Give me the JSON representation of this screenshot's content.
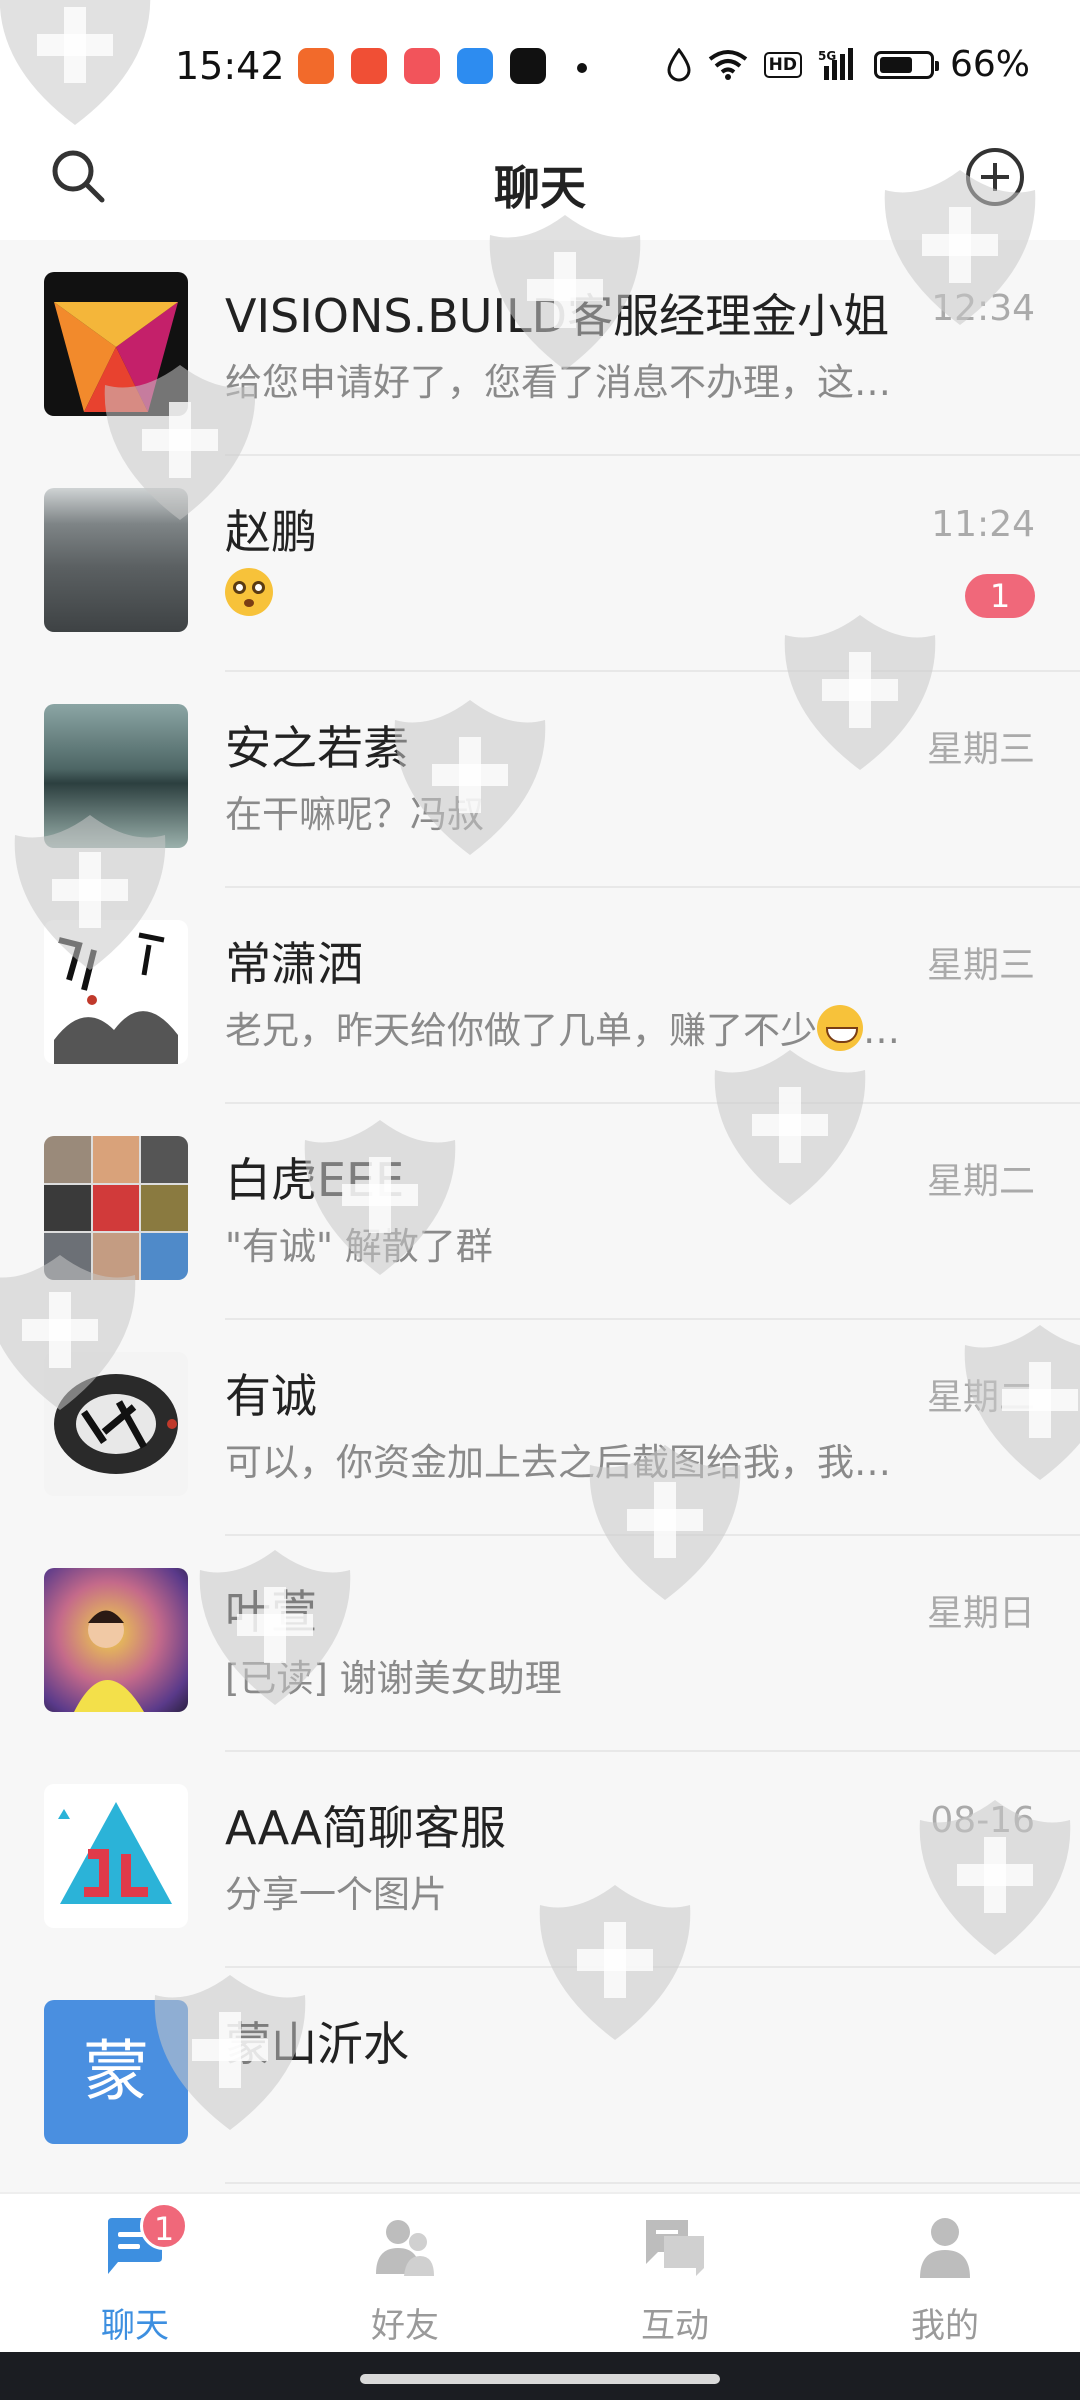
{
  "status_bar": {
    "time": "15:42",
    "network": "5G",
    "hd_label": "HD",
    "battery_text": "66%",
    "battery_level": 0.66,
    "app_icons": [
      "app-notification-icon",
      "video-app-icon",
      "app-notification-icon",
      "chat-app-icon",
      "arrow-app-icon"
    ]
  },
  "header": {
    "title": "聊天",
    "left_icon": "search-icon",
    "right_icon": "plus-circle-icon"
  },
  "chats": [
    {
      "name": "VISIONS.BUILD客服经理金小姐",
      "time": "12:34",
      "preview": "给您申请好了，您看了消息不办理，这…",
      "badge": ""
    },
    {
      "name": "赵鹏",
      "time": "11:24",
      "preview": "",
      "preview_emoji": "flushed-face-emoji",
      "badge": "1"
    },
    {
      "name": "安之若素",
      "time": "星期三",
      "preview": "在干嘛呢？冯叔",
      "badge": ""
    },
    {
      "name": "常潇洒",
      "time": "星期三",
      "preview": "老兄，昨天给你做了几单，赚了不少",
      "preview_suffix": "…",
      "preview_emoji": "grinning-face-emoji",
      "badge": ""
    },
    {
      "name": "白虎EEE",
      "time": "星期二",
      "preview": "\"有诚\" 解散了群",
      "badge": ""
    },
    {
      "name": "有诚",
      "time": "星期二",
      "preview": "可以，你资金加上去之后截图给我，我…",
      "badge": ""
    },
    {
      "name": "叶萱",
      "time": "星期日",
      "preview": "[已读] 谢谢美女助理",
      "badge": ""
    },
    {
      "name": "AAA简聊客服",
      "time": "08-16",
      "preview": "分享一个图片",
      "badge": ""
    },
    {
      "name": "蒙山沂水",
      "time": "",
      "preview": "",
      "avatar_text": "蒙",
      "badge": ""
    }
  ],
  "tabs": [
    {
      "label": "聊天",
      "icon": "chat-tab-icon",
      "active": true,
      "badge": "1"
    },
    {
      "label": "好友",
      "icon": "friends-tab-icon",
      "active": false,
      "badge": ""
    },
    {
      "label": "互动",
      "icon": "interact-tab-icon",
      "active": false,
      "badge": ""
    },
    {
      "label": "我的",
      "icon": "profile-tab-icon",
      "active": false,
      "badge": ""
    }
  ],
  "colors": {
    "accent": "#3d8fe0",
    "badge": "#f0687a",
    "background": "#f7f7f7"
  }
}
